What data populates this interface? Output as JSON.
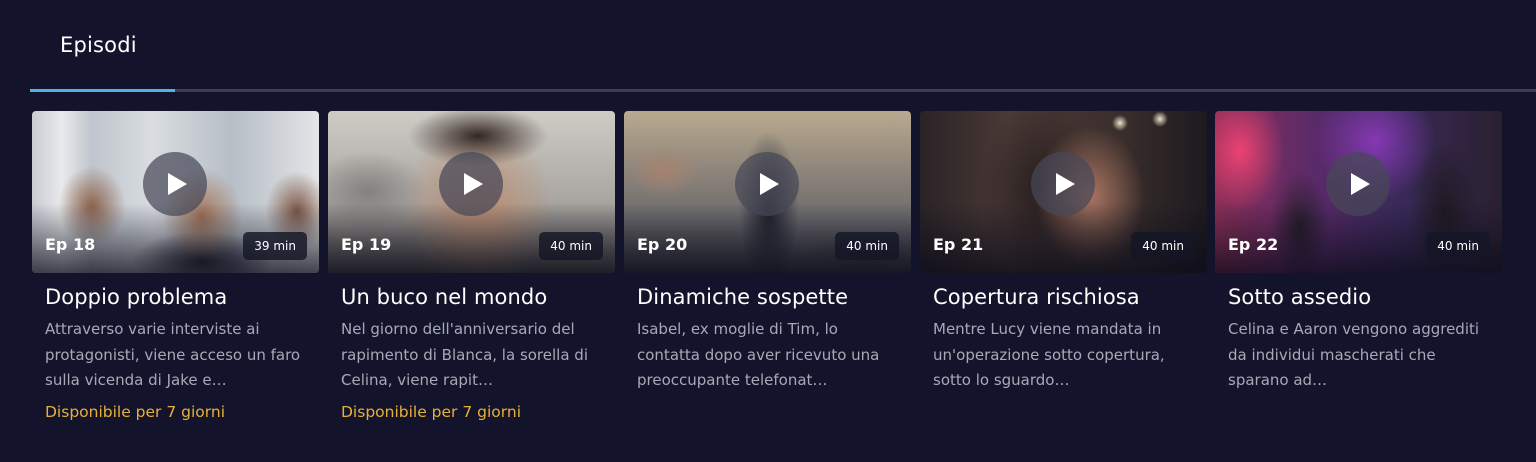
{
  "tabs": [
    {
      "label": "Episodi",
      "active": true
    }
  ],
  "colors": {
    "background": "#13142b",
    "tab_indicator": "#4fb1e6",
    "availability": "#e6b13a",
    "description": "#a7a9b7"
  },
  "episodes": [
    {
      "number": "Ep 18",
      "duration": "39 min",
      "title": "Doppio problema",
      "description": "Attraverso varie interviste ai protagonisti, viene acceso un faro sulla vicenda di Jake e…",
      "availability": "Disponibile per 7 giorni",
      "icon": "play-icon"
    },
    {
      "number": "Ep 19",
      "duration": "40 min",
      "title": "Un buco nel mondo",
      "description": "Nel giorno dell'anniversario del rapimento di Blanca, la sorella di Celina, viene rapit…",
      "availability": "Disponibile per 7 giorni",
      "icon": "play-icon"
    },
    {
      "number": "Ep 20",
      "duration": "40 min",
      "title": "Dinamiche sospette",
      "description": "Isabel, ex moglie di Tim, lo contatta dopo aver ricevuto una preoccupante telefonat…",
      "availability": "",
      "icon": "play-icon"
    },
    {
      "number": "Ep 21",
      "duration": "40 min",
      "title": "Copertura rischiosa",
      "description": "Mentre Lucy viene mandata in un'operazione sotto copertura, sotto lo sguardo…",
      "availability": "",
      "icon": "play-icon"
    },
    {
      "number": "Ep 22",
      "duration": "40 min",
      "title": "Sotto assedio",
      "description": "Celina e Aaron vengono aggrediti da individui mascherati che sparano ad…",
      "availability": "",
      "icon": "play-icon"
    }
  ]
}
